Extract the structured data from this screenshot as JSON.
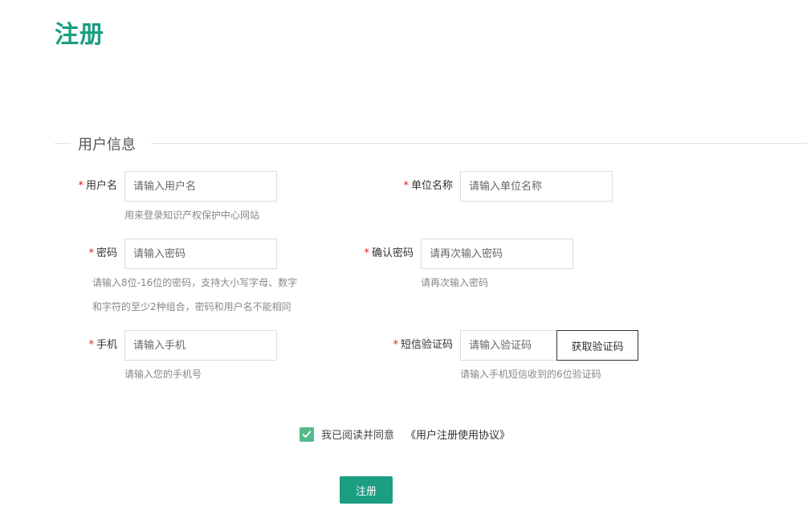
{
  "page": {
    "title": "注册"
  },
  "section": {
    "legend": "用户信息"
  },
  "form": {
    "username": {
      "label": "用户名",
      "placeholder": "请输入用户名",
      "hint": "用来登录知识产权保护中心网站",
      "required": "*"
    },
    "org_name": {
      "label": "单位名称",
      "placeholder": "请输入单位名称",
      "required": "*"
    },
    "password": {
      "label": "密码",
      "placeholder": "请输入密码",
      "hint_line1": "请输入8位-16位的密码，支持大小写字母、数字",
      "hint_line2": "和字符的至少2种组合，密码和用户名不能相同",
      "required": "*"
    },
    "confirm_password": {
      "label": "确认密码",
      "placeholder": "请再次输入密码",
      "hint": "请再次输入密码",
      "required": "*"
    },
    "phone": {
      "label": "手机",
      "placeholder": "请输入手机",
      "hint": "请输入您的手机号",
      "required": "*"
    },
    "sms_code": {
      "label": "短信验证码",
      "placeholder": "请输入验证码",
      "hint": "请输入手机短信收到的6位验证码",
      "button_label": "获取验证码",
      "required": "*"
    }
  },
  "agreement": {
    "checked": true,
    "text": "我已阅读并同意",
    "link": "《用户注册使用协议》"
  },
  "submit": {
    "label": "注册"
  },
  "colors": {
    "accent": "#1b9e82",
    "checkbox": "#55b98a",
    "required": "#e02020"
  },
  "icons": {
    "checkbox": "check-icon"
  }
}
